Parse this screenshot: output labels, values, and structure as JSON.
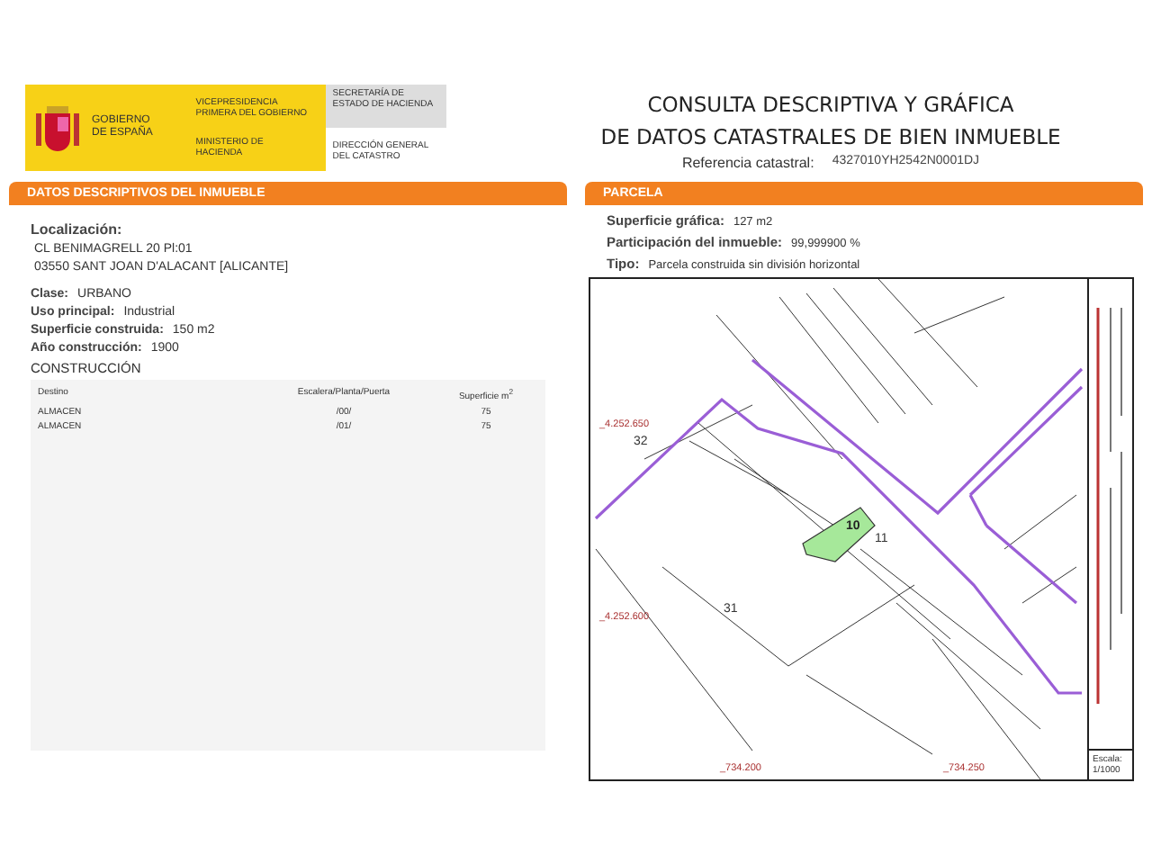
{
  "header": {
    "logo_text": "GOBIERNO DE ESPAÑA",
    "vicepresidencia": "VICEPRESIDENCIA PRIMERA DEL GOBIERNO",
    "ministerio": "MINISTERIO DE HACIENDA",
    "secretaria": "SECRETARÍA DE ESTADO DE HACIENDA",
    "direccion": "DIRECCIÓN GENERAL DEL CATASTRO"
  },
  "title_lines": [
    "CONSULTA DESCRIPTIVA Y GRÁFICA",
    "DE DATOS CATASTRALES DE BIEN INMUEBLE"
  ],
  "referencia": {
    "label": "Referencia catastral:",
    "value": "4327010YH2542N0001DJ"
  },
  "left_panel": {
    "title": "DATOS DESCRIPTIVOS DEL INMUEBLE",
    "localizacion": {
      "label": "Localización:",
      "lines": [
        "CL BENIMAGRELL 20 Pl:01",
        "03550 SANT JOAN D'ALACANT [ALICANTE]"
      ]
    },
    "fields": [
      {
        "label": "Clase:",
        "value": "URBANO"
      },
      {
        "label": "Uso principal:",
        "value": "Industrial"
      },
      {
        "label": "Superficie construida:",
        "value": "150 m2"
      },
      {
        "label": "Año construcción:",
        "value": "1900"
      }
    ],
    "construccion": {
      "title": "CONSTRUCCIÓN",
      "columns": [
        "Destino",
        "Escalera/Planta/Puerta",
        "Superficie m$^{2}$"
      ],
      "rows": [
        [
          "ALMACEN",
          "/00/",
          "75"
        ],
        [
          "ALMACEN",
          "/01/",
          "75"
        ]
      ]
    }
  },
  "right_panel": {
    "title": "PARCELA",
    "fields": [
      {
        "label": "Superficie gráfica:",
        "value": "127 m2"
      },
      {
        "label": "Participación del inmueble:",
        "value": "99,999900 %"
      },
      {
        "label": "Tipo:",
        "value": "Parcela construida sin división horizontal"
      }
    ],
    "map": {
      "labels": [
        {
          "kind": "coord",
          "text": "_4.252.650"
        },
        {
          "kind": "coord",
          "text": "_4.252.600"
        },
        {
          "kind": "coord",
          "text": "_734.200"
        },
        {
          "kind": "coord",
          "text": "_734.250"
        },
        {
          "kind": "parcel",
          "text": "32"
        },
        {
          "kind": "parcel",
          "text": "31"
        },
        {
          "kind": "highlight",
          "text": "10"
        },
        {
          "kind": "parcel",
          "text": "11"
        }
      ],
      "scale_label": "Escala:",
      "scale": "1/1000"
    }
  }
}
